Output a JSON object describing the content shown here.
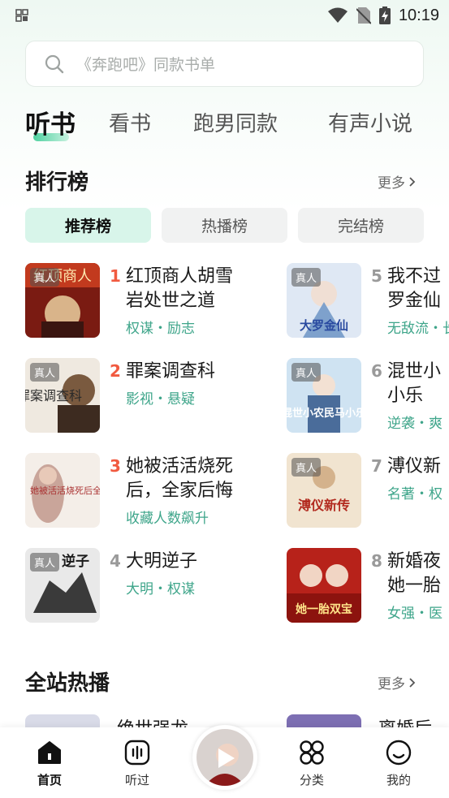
{
  "status_bar": {
    "time": "10:19"
  },
  "search": {
    "placeholder": "《奔跑吧》同款书单"
  },
  "tabs": [
    {
      "label": "听书"
    },
    {
      "label": "看书"
    },
    {
      "label": "跑男同款"
    },
    {
      "label": "有声小说"
    }
  ],
  "ranking": {
    "title": "排行榜",
    "more": "更多",
    "tabs": [
      {
        "label": "推荐榜"
      },
      {
        "label": "热播榜"
      },
      {
        "label": "完结榜"
      }
    ],
    "items": [
      {
        "rank": "1",
        "tag": "真人",
        "title": "红顶商人胡雪岩处世之道",
        "labels": "权谋・励志"
      },
      {
        "rank": "2",
        "tag": "真人",
        "title": "罪案调查科",
        "labels": "影视・悬疑"
      },
      {
        "rank": "3",
        "tag": "",
        "title": "她被活活烧死后，全家后悔",
        "labels": "收藏人数飙升"
      },
      {
        "rank": "4",
        "tag": "真人",
        "title": "大明逆子",
        "labels": "大明・权谋"
      },
      {
        "rank": "5",
        "tag": "真人",
        "title": "我不过罗金仙",
        "labels": "无敌流・长"
      },
      {
        "rank": "6",
        "tag": "真人",
        "title": "混世小小乐",
        "labels": "逆袭・爽"
      },
      {
        "rank": "7",
        "tag": "真人",
        "title": "溥仪新",
        "labels": "名著・权"
      },
      {
        "rank": "8",
        "tag": "",
        "title": "新婚夜她一胎",
        "labels": "女强・医"
      }
    ],
    "cover_texts": {
      "c1": "红顶商人",
      "c2": "罪案调查科",
      "c3": "她被活活烧死后全家后悔了",
      "c4": "逆子",
      "c5": "大罗金仙",
      "c6": "混世小农民马小乐",
      "c7": "溥仪新传",
      "c8": "她一胎双宝"
    }
  },
  "hot": {
    "title": "全站热播",
    "more": "更多",
    "items": [
      {
        "title": "绝世强龙"
      },
      {
        "title": "离婚后"
      }
    ]
  },
  "bottom_nav": [
    {
      "label": "首页"
    },
    {
      "label": "听过"
    },
    {
      "label": "分类"
    },
    {
      "label": "我的"
    }
  ],
  "colors": {
    "accent": "#3ea58a",
    "rank_hot": "#f15a40",
    "tab_active_bg": "#d8f5ea"
  }
}
